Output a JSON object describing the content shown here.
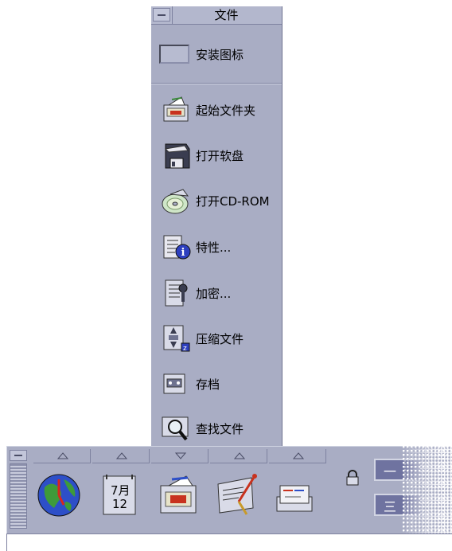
{
  "subpanel": {
    "title": "文件",
    "install_label": "安装图标",
    "items": [
      {
        "label": "起始文件夹",
        "icon": "home-folder-icon"
      },
      {
        "label": "打开软盘",
        "icon": "floppy-icon"
      },
      {
        "label": "打开CD-ROM",
        "icon": "cdrom-icon"
      },
      {
        "label": "特性...",
        "icon": "properties-icon"
      },
      {
        "label": "加密...",
        "icon": "encrypt-icon"
      },
      {
        "label": "压缩文件",
        "icon": "compress-icon"
      },
      {
        "label": "存档",
        "icon": "archive-icon"
      },
      {
        "label": "查找文件",
        "icon": "find-file-icon"
      }
    ]
  },
  "frontpanel": {
    "calendar": {
      "month": "7月",
      "day": "12"
    },
    "workspaces": [
      "一",
      "三"
    ]
  }
}
